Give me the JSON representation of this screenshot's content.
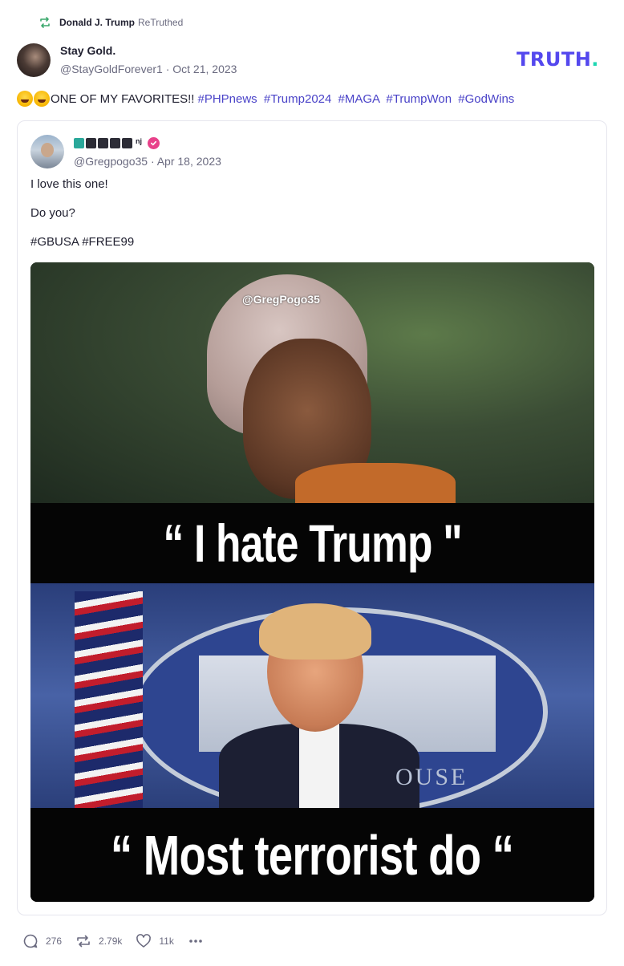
{
  "retruth": {
    "name": "Donald J. Trump",
    "label": "ReTruthed",
    "icon": "retruth-icon"
  },
  "author": {
    "display_name": "Stay Gold.",
    "meta": "@StayGoldForever1 · Oct 21, 2023"
  },
  "logo": {
    "text": "TRUTH",
    "dot": ".",
    "color": "#5448ee",
    "dot_color": "#1ed7b2"
  },
  "post": {
    "text": "ONE OF MY FAVORITES!!",
    "emojis": [
      "rolling-on-floor-laughing-emoji",
      "rolling-on-floor-laughing-emoji"
    ],
    "hashtags": [
      "#PHPnews",
      "#Trump2024",
      "#MAGA",
      "#TrumpWon",
      "#GodWins"
    ]
  },
  "quoted": {
    "name_suffix": "nj",
    "meta": "@Gregpogo35 · Apr 18, 2023",
    "line1": "I love this one!",
    "line2": "Do you?",
    "hashtags": "#GBUSA #FREE99",
    "verified_color": "#e8418a",
    "image": {
      "watermark": "@GregPogo35",
      "caption_top": "“ I hate Trump \"",
      "caption_bottom": "“ Most terrorist do “",
      "background_text": "OUSE"
    }
  },
  "actions": {
    "replies": "276",
    "retruths": "2.79k",
    "likes": "11k",
    "more_icon": "more-icon"
  }
}
